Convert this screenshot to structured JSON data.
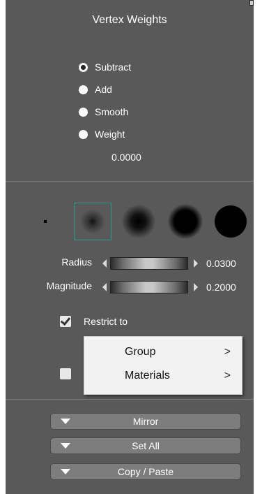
{
  "panel": {
    "title": "Vertex Weights",
    "modes": [
      {
        "label": "Subtract",
        "selected": true
      },
      {
        "label": "Add",
        "selected": false
      },
      {
        "label": "Smooth",
        "selected": false
      },
      {
        "label": "Weight",
        "selected": false
      }
    ],
    "weight_value": "0.0000"
  },
  "brushes": [
    "tiny-dot-brush",
    "soft-small-brush",
    "soft-medium-brush",
    "soft-large-brush",
    "hard-large-brush"
  ],
  "sliders": {
    "radius": {
      "label": "Radius",
      "value": "0.0300"
    },
    "magnitude": {
      "label": "Magnitude",
      "value": "0.2000"
    }
  },
  "restrict": {
    "label": "Restrict to",
    "checked": true
  },
  "dropdown_menu": {
    "items": [
      {
        "label": "Group",
        "arrow": ">"
      },
      {
        "label": "Materials",
        "arrow": ">"
      }
    ]
  },
  "buttons": {
    "mirror": "Mirror",
    "set_all": "Set All",
    "copy_paste": "Copy / Paste"
  },
  "colors": {
    "panel_bg": "#595959",
    "selection_border": "#2c9a8a",
    "menu_bg": "#f2f2f2"
  }
}
